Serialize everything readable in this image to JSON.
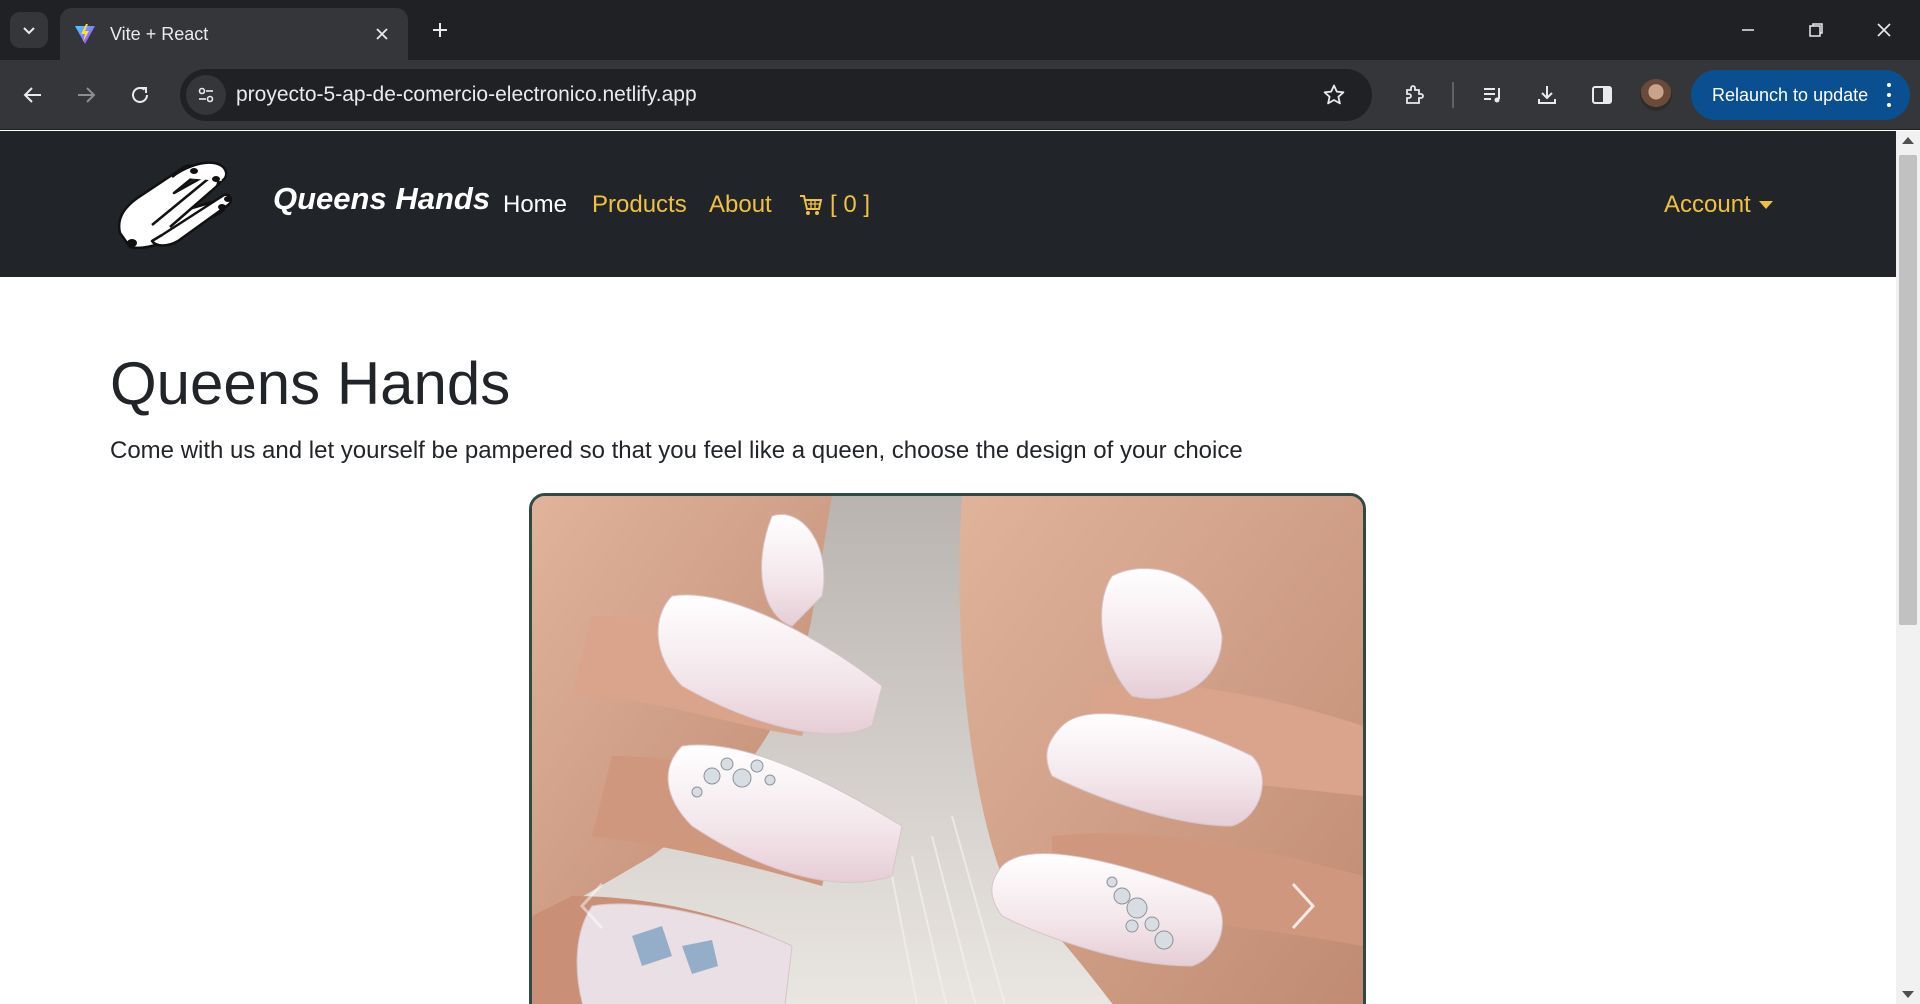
{
  "browser": {
    "tab_title": "Vite + React",
    "url": "proyecto-5-ap-de-comercio-electronico.netlify.app",
    "relaunch_label": "Relaunch to update"
  },
  "site": {
    "brand": "Queens Hands",
    "nav": {
      "home": "Home",
      "products": "Products",
      "about": "About",
      "cart": "[ 0 ]",
      "account": "Account"
    },
    "hero": {
      "title": "Queens Hands",
      "subtitle": "Come with us and let yourself be pampered so that you feel like a queen, choose the design of your choice"
    }
  },
  "colors": {
    "nav_bg": "#212529",
    "nav_link": "#f0c040",
    "relaunch_bg": "#0a4f8f",
    "carousel_border": "#2f4a44"
  },
  "icons": [
    "chevron-down-icon",
    "vite-favicon-icon",
    "close-icon",
    "plus-icon",
    "minimize-icon",
    "restore-icon",
    "back-icon",
    "forward-icon",
    "reload-icon",
    "site-settings-icon",
    "bookmark-star-icon",
    "extensions-icon",
    "media-icon",
    "download-icon",
    "side-panel-icon",
    "cart-icon",
    "carousel-prev-icon",
    "carousel-next-icon"
  ]
}
